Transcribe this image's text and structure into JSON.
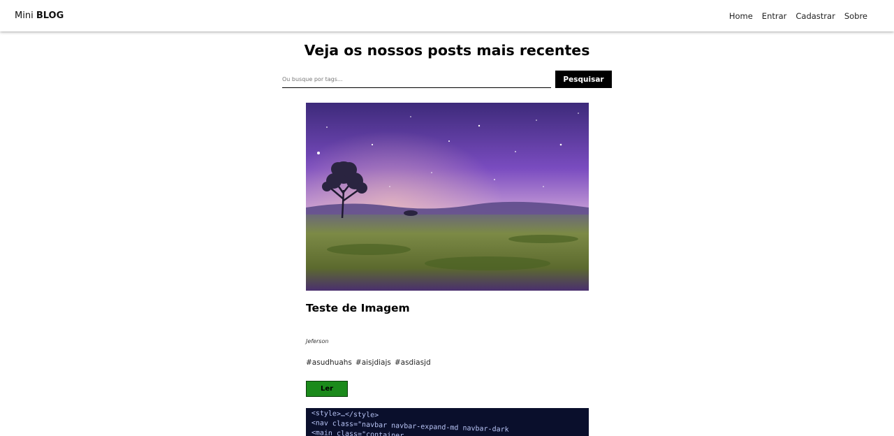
{
  "navbar": {
    "brand_prefix": "Mini",
    "brand_strong": "BLOG",
    "links": [
      "Home",
      "Entrar",
      "Cadastrar",
      "Sobre"
    ]
  },
  "main": {
    "title": "Veja os nossos posts mais recentes",
    "search": {
      "placeholder": "Ou busque por tags...",
      "value": "",
      "button_label": "Pesquisar"
    }
  },
  "posts": [
    {
      "title": "Teste de Imagem",
      "author": "Jeferson",
      "tags": [
        "#asudhuahs",
        "#aisjdiajs",
        "#asdiasjd"
      ],
      "read_label": "Ler",
      "image_desc": "purple-night-landscape-tree"
    },
    {
      "image_desc": "code-editor-screenshot",
      "code_lines": [
        "<style>…</style>",
        "<nav class=\"navbar navbar-expand-md navbar-dark",
        "<main class=\"container"
      ]
    }
  ],
  "colors": {
    "read_button": "#1b8a1b",
    "search_button": "#000000"
  }
}
